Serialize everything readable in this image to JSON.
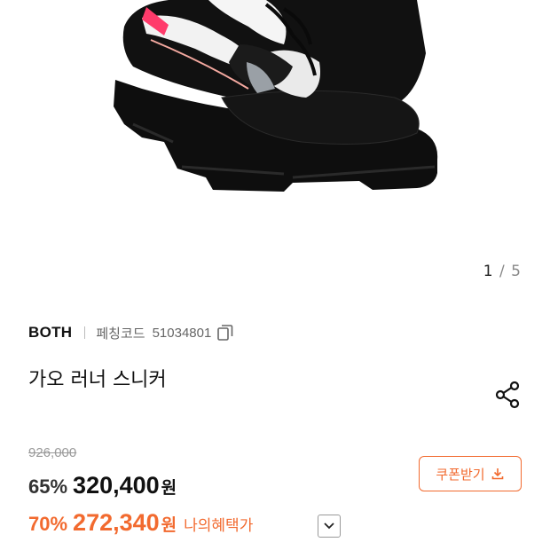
{
  "gallery": {
    "current": "1",
    "separator": "/",
    "total": "5",
    "image_alt_icon": "shoe-product-image"
  },
  "product": {
    "brand": "BOTH",
    "code_label": "페칭코드",
    "code_value": "51034801",
    "name": "가오 러너 스니커"
  },
  "price": {
    "original": "926,000",
    "discount_rate": "65%",
    "sale_price": "320,400",
    "currency": "원"
  },
  "benefit": {
    "discount_rate": "70%",
    "price": "272,340",
    "currency": "원",
    "label": "나의혜택가"
  },
  "coupon": {
    "label": "쿠폰받기"
  },
  "colors": {
    "accent": "#f26a2f",
    "text": "#111111",
    "muted": "#999999"
  },
  "icons": {
    "copy": "copy-icon",
    "share": "share-icon",
    "download": "download-icon",
    "dropdown": "chevron-down-icon"
  }
}
